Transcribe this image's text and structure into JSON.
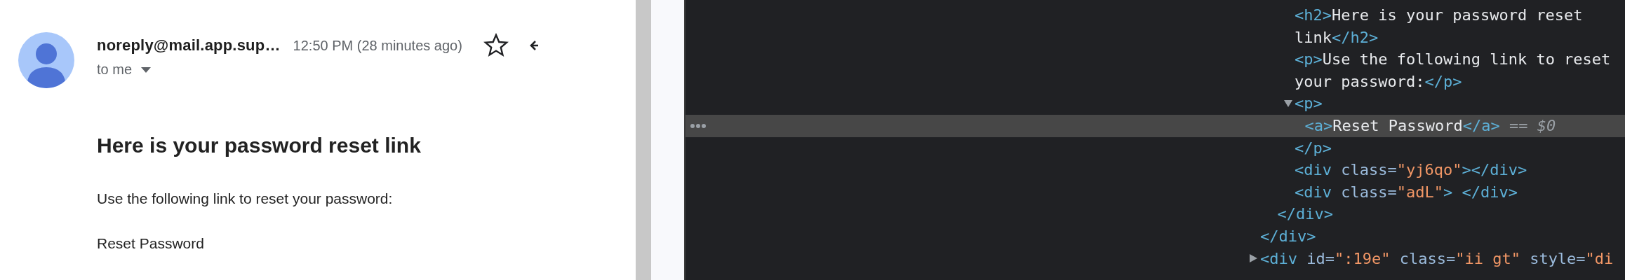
{
  "email": {
    "sender": "noreply@mail.app.sup…",
    "time": "12:50 PM (28 minutes ago)",
    "starred": false,
    "recipient": "to me",
    "heading": "Here is your password reset link",
    "body": "Use the following link to reset your password:",
    "link": "Reset Password"
  },
  "elements_tree": [
    {
      "children": [
        {
          "children": [
            {
              "selected": false,
              "open": [
                {
                  "kind": "tag",
                  "text": "<h2>"
                },
                {
                  "kind": "text",
                  "text": "Here is your password reset link"
                },
                {
                  "kind": "tag",
                  "text": "</h2>"
                }
              ]
            },
            {
              "selected": false,
              "open": [
                {
                  "kind": "tag",
                  "text": "<p>"
                },
                {
                  "kind": "text",
                  "text": "Use the following link to reset your password:"
                },
                {
                  "kind": "tag",
                  "text": "</p>"
                }
              ]
            },
            {
              "selected": false,
              "expanded": true,
              "open": [
                {
                  "kind": "tag",
                  "text": "<p>"
                }
              ],
              "children": [
                {
                  "selected": true,
                  "open": [
                    {
                      "kind": "tag",
                      "text": "<a>"
                    },
                    {
                      "kind": "text",
                      "text": "Reset Password"
                    },
                    {
                      "kind": "tag",
                      "text": "</a>"
                    },
                    {
                      "kind": "ref",
                      "text": " == *$0*"
                    }
                  ]
                }
              ],
              "close": [
                {
                  "kind": "tag",
                  "text": "</p>"
                }
              ]
            },
            {
              "selected": false,
              "open": [
                {
                  "kind": "tag",
                  "text": "<div"
                },
                {
                  "kind": "attr",
                  "text": " class="
                },
                {
                  "kind": "value",
                  "text": "\"yj6qo\""
                },
                {
                  "kind": "tag",
                  "text": "></div>"
                }
              ]
            },
            {
              "selected": false,
              "open": [
                {
                  "kind": "tag",
                  "text": "<div"
                },
                {
                  "kind": "attr",
                  "text": " class="
                },
                {
                  "kind": "value",
                  "text": "\"adL\""
                },
                {
                  "kind": "tag",
                  "text": "> </div>"
                }
              ]
            }
          ],
          "close": [
            {
              "kind": "tag",
              "text": "</div>"
            }
          ]
        }
      ],
      "close": [
        {
          "kind": "tag",
          "text": "</div>"
        }
      ]
    },
    {
      "selected": false,
      "expanded": false,
      "open": [
        {
          "kind": "tag",
          "text": "<div"
        },
        {
          "kind": "attr",
          "text": " id="
        },
        {
          "kind": "value",
          "text": "\":19e\""
        },
        {
          "kind": "attr",
          "text": " class="
        },
        {
          "kind": "value",
          "text": "\"ii gt\""
        },
        {
          "kind": "attr",
          "text": " style="
        },
        {
          "kind": "value",
          "text": "\"di"
        }
      ]
    }
  ]
}
